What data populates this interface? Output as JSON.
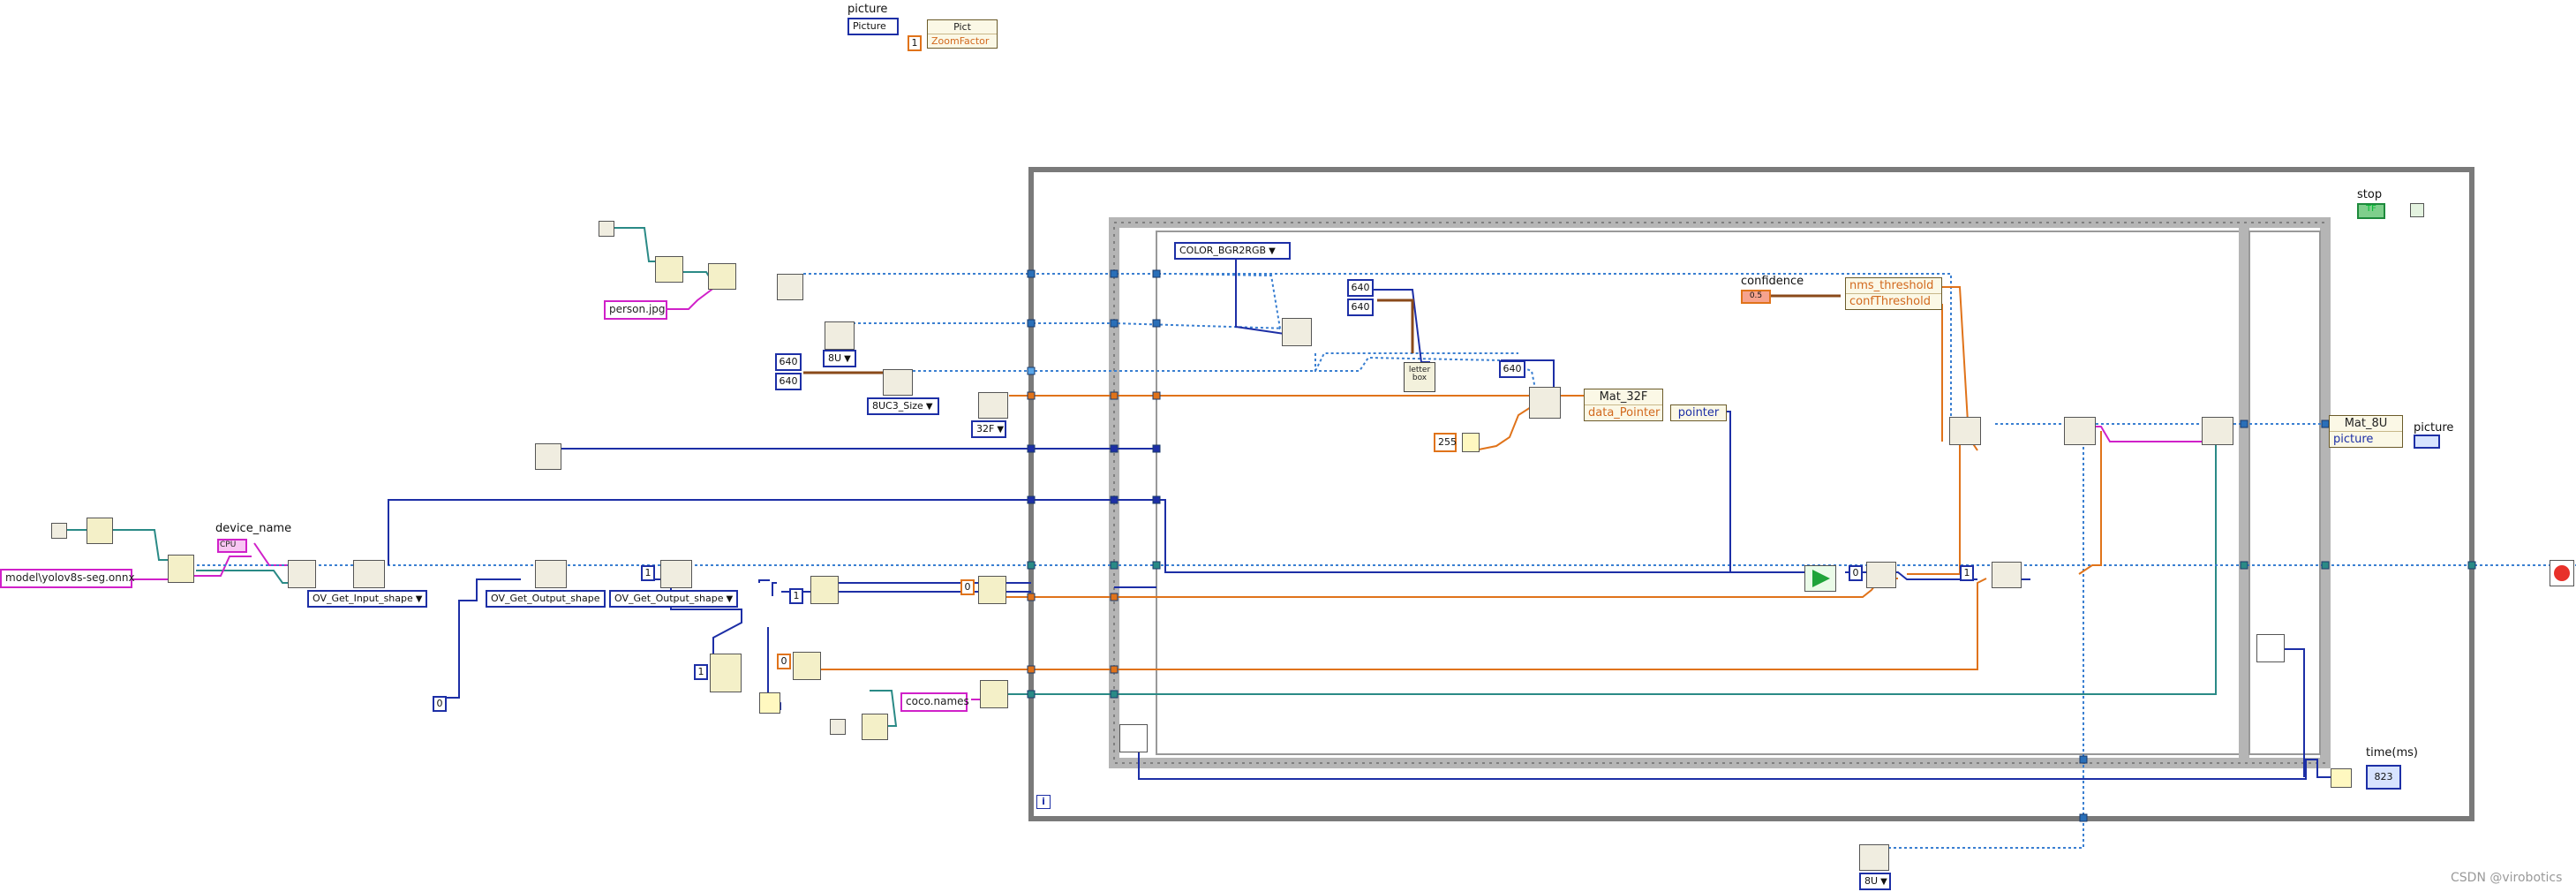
{
  "palette": {
    "string_wire": "#d021c9",
    "int_wire": "#1d2fa6",
    "float_wire": "#e0731a",
    "refnum_wire": "#2a8a86",
    "cluster_wire": "#8a4a1a",
    "dotted_wire": "#3a7fd1",
    "loop_border": "#7a7a7a",
    "seq_border": "#b5b5b5"
  },
  "picture_section": {
    "label": "picture",
    "control": "Picture",
    "bundle_title": "Pict",
    "zoom_const": "1",
    "zoom_label": "ZoomFactor"
  },
  "inputs": {
    "model_path": "model\\yolov8s-seg.onnx",
    "device_label": "device_name",
    "device_value": "CPU",
    "image_path": "person.jpg",
    "coco_names": "coco.names",
    "zero_const": "0",
    "one_const_a": "1",
    "one_const_b": "1",
    "one_const_c": "1",
    "zero_const_b": "0",
    "zero_const_c": "0",
    "zero_const_d": "0"
  },
  "size_consts": {
    "w": "640",
    "h": "640",
    "inner_w": "640",
    "inner_h": "640",
    "resize": "640",
    "scale": "255"
  },
  "enums": {
    "input_shape": "OV_Get_Input_shape",
    "output_shape_a": "OV_Get_Output_shape",
    "output_shape_b": "OV_Get_Output_shape",
    "type_8u": "8U",
    "type_8uc3": "8UC3_Size",
    "type_32f": "32F",
    "color_conv": "COLOR_BGR2RGB",
    "type_8u_bottom": "8U"
  },
  "inner_nodes": {
    "mat32f_title": "Mat_32F",
    "data_pointer": "data_Pointer",
    "pointer_label": "pointer",
    "confidence_label": "confidence",
    "confidence_value": "0.5",
    "nms_label": "nms_threshold",
    "conf_threshold_label": "confThreshold",
    "letterbox_label": "letter box",
    "mat8u_title": "Mat_8U",
    "picture_label": "picture",
    "picture_out": "picture",
    "stop_label": "stop",
    "stop_value": "TF",
    "time_label": "time(ms)",
    "time_value": "823",
    "iter_label": "i"
  },
  "icon_names": [
    "vi-file-path-icon",
    "vi-read-image-icon",
    "vi-openvino-core-icon",
    "vi-mat-icon",
    "vi-timer-icon",
    "vi-run-arrow-icon",
    "vi-stop-icon"
  ],
  "watermark": "CSDN @virobotics"
}
